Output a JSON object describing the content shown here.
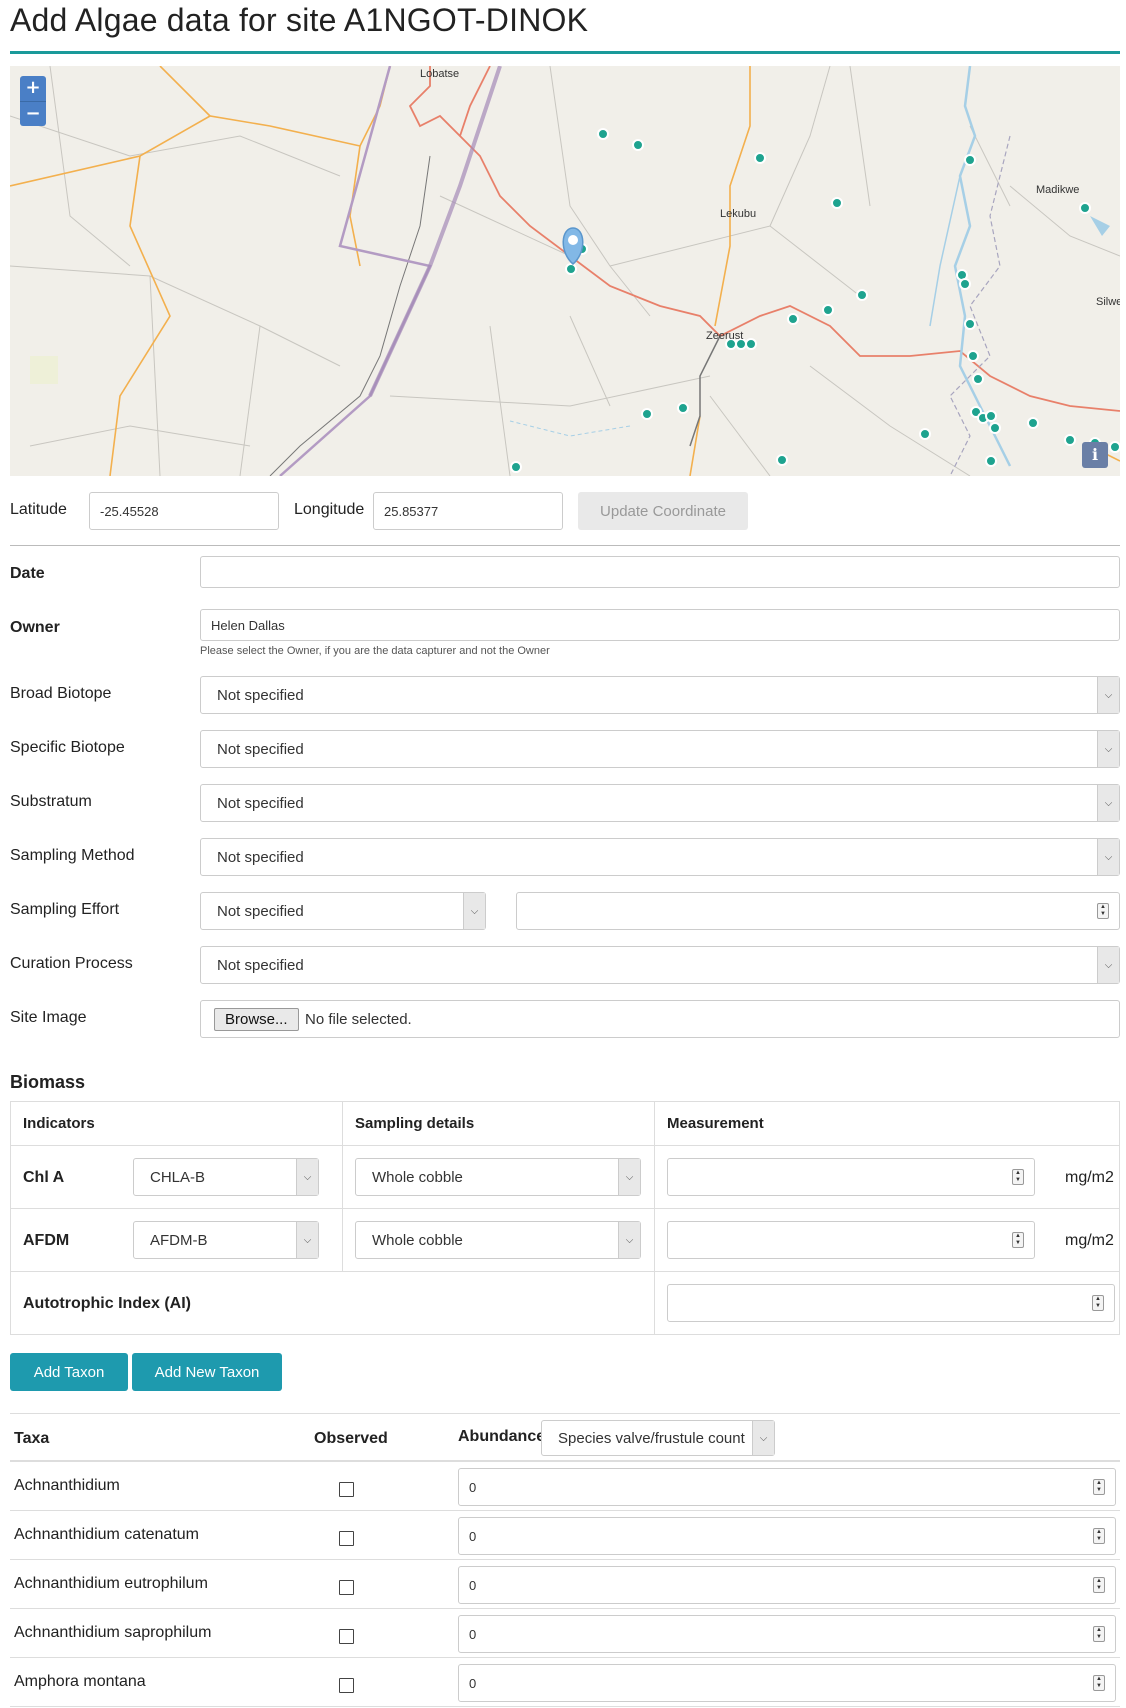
{
  "page": {
    "title": "Add Algae data for site A1NGOT-DINOK"
  },
  "map": {
    "zoom_in": "+",
    "zoom_out": "−",
    "info": "i",
    "places": {
      "lobatse": "Lobatse",
      "lekubu": "Lekubu",
      "madikwe": "Madikwe",
      "zeerust": "Zeerust",
      "silwe": "Silwe"
    }
  },
  "coordinates": {
    "latitude_label": "Latitude",
    "latitude_value": "-25.45528",
    "longitude_label": "Longitude",
    "longitude_value": "25.85377",
    "update_button": "Update Coordinate"
  },
  "form": {
    "date_label": "Date",
    "date_value": "",
    "owner_label": "Owner",
    "owner_value": "Helen Dallas",
    "owner_help": "Please select the Owner, if you are the data capturer and not the Owner",
    "broad_biotope_label": "Broad Biotope",
    "broad_biotope_value": "Not specified",
    "specific_biotope_label": "Specific Biotope",
    "specific_biotope_value": "Not specified",
    "substratum_label": "Substratum",
    "substratum_value": "Not specified",
    "sampling_method_label": "Sampling Method",
    "sampling_method_value": "Not specified",
    "sampling_effort_label": "Sampling Effort",
    "sampling_effort_value": "Not specified",
    "sampling_effort_amount": "",
    "curation_process_label": "Curation Process",
    "curation_process_value": "Not specified",
    "site_image_label": "Site Image",
    "browse_button": "Browse...",
    "no_file": "No file selected."
  },
  "biomass": {
    "title": "Biomass",
    "headers": {
      "indicators": "Indicators",
      "sampling_details": "Sampling details",
      "measurement": "Measurement"
    },
    "rows": [
      {
        "name": "Chl A",
        "indicator": "CHLA-B",
        "sampling": "Whole cobble",
        "value": "",
        "unit": "mg/m2"
      },
      {
        "name": "AFDM",
        "indicator": "AFDM-B",
        "sampling": "Whole cobble",
        "value": "",
        "unit": "mg/m2"
      }
    ],
    "autotrophic_label": "Autotrophic Index (AI)",
    "autotrophic_value": ""
  },
  "actions": {
    "add_taxon": "Add Taxon",
    "add_new_taxon": "Add New Taxon"
  },
  "taxa": {
    "headers": {
      "taxa": "Taxa",
      "observed": "Observed",
      "abundance": "Abundance",
      "abundance_type": "Species valve/frustule count"
    },
    "rows": [
      {
        "name": "Achnanthidium",
        "observed": false,
        "value": "0"
      },
      {
        "name": "Achnanthidium catenatum",
        "observed": false,
        "value": "0"
      },
      {
        "name": "Achnanthidium eutrophilum",
        "observed": false,
        "value": "0"
      },
      {
        "name": "Achnanthidium saprophilum",
        "observed": false,
        "value": "0"
      },
      {
        "name": "Amphora montana",
        "observed": false,
        "value": "0"
      }
    ]
  },
  "colors": {
    "accent": "#1a9a9a",
    "button": "#1e9aae",
    "marker": "#1ea38f"
  }
}
